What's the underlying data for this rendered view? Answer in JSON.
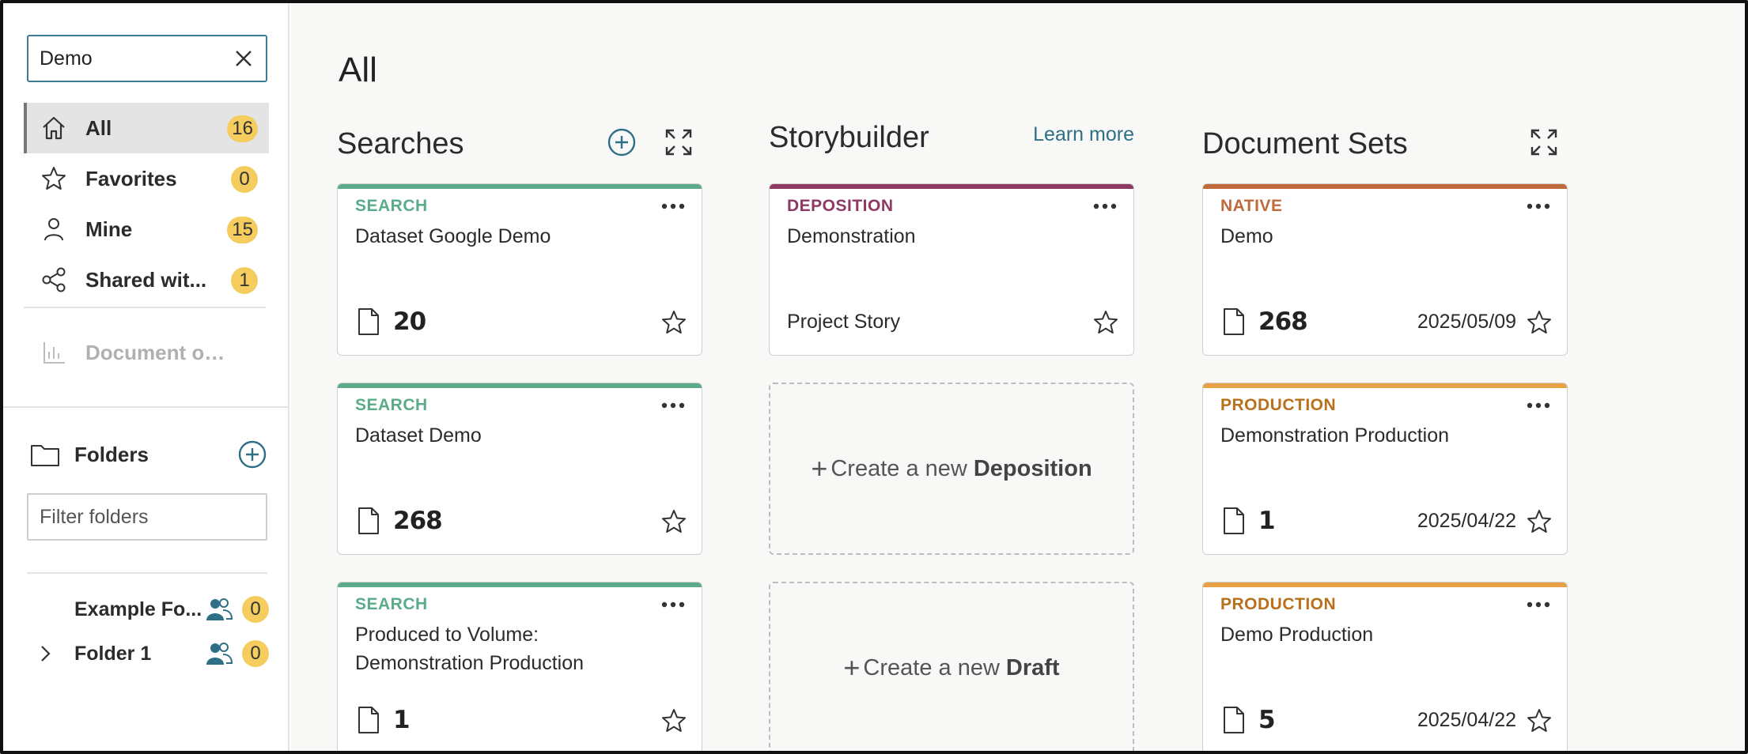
{
  "search": {
    "value": "Demo"
  },
  "nav": {
    "items": [
      {
        "label": "All",
        "count": "16"
      },
      {
        "label": "Favorites",
        "count": "0"
      },
      {
        "label": "Mine",
        "count": "15"
      },
      {
        "label": "Shared wit...",
        "count": "1"
      }
    ],
    "document_overview": "Document over..."
  },
  "folders": {
    "label": "Folders",
    "filter_placeholder": "Filter folders",
    "items": [
      {
        "name": "Example Fo...",
        "count": "0"
      },
      {
        "name": "Folder 1",
        "count": "0"
      }
    ]
  },
  "main": {
    "title": "All",
    "searches": {
      "title": "Searches",
      "cards": [
        {
          "type": "SEARCH",
          "name": "Dataset Google Demo",
          "count": "20"
        },
        {
          "type": "SEARCH",
          "name": "Dataset Demo",
          "count": "268"
        },
        {
          "type": "SEARCH",
          "name": "Produced to Volume: Demonstration Production",
          "count": "1"
        }
      ]
    },
    "storybuilder": {
      "title": "Storybuilder",
      "learn_more": "Learn more",
      "card": {
        "type": "DEPOSITION",
        "name": "Demonstration",
        "subtitle": "Project Story"
      },
      "create_deposition": {
        "prefix": "Create a new",
        "bold": "Deposition"
      },
      "create_draft": {
        "prefix": "Create a new",
        "bold": "Draft"
      }
    },
    "document_sets": {
      "title": "Document Sets",
      "cards": [
        {
          "type": "NATIVE",
          "name": "Demo",
          "count": "268",
          "date": "2025/05/09"
        },
        {
          "type": "PRODUCTION",
          "name": "Demonstration Production",
          "count": "1",
          "date": "2025/04/22"
        },
        {
          "type": "PRODUCTION",
          "name": "Demo Production",
          "count": "5",
          "date": "2025/04/22"
        }
      ]
    }
  },
  "colors": {
    "search": "#5aab8a",
    "deposition": "#8f3a63",
    "native": "#c06a3c",
    "production": "#e8a044",
    "production_text": "#b9701c",
    "badge": "#f5cc5e",
    "accent": "#2e6f86"
  }
}
